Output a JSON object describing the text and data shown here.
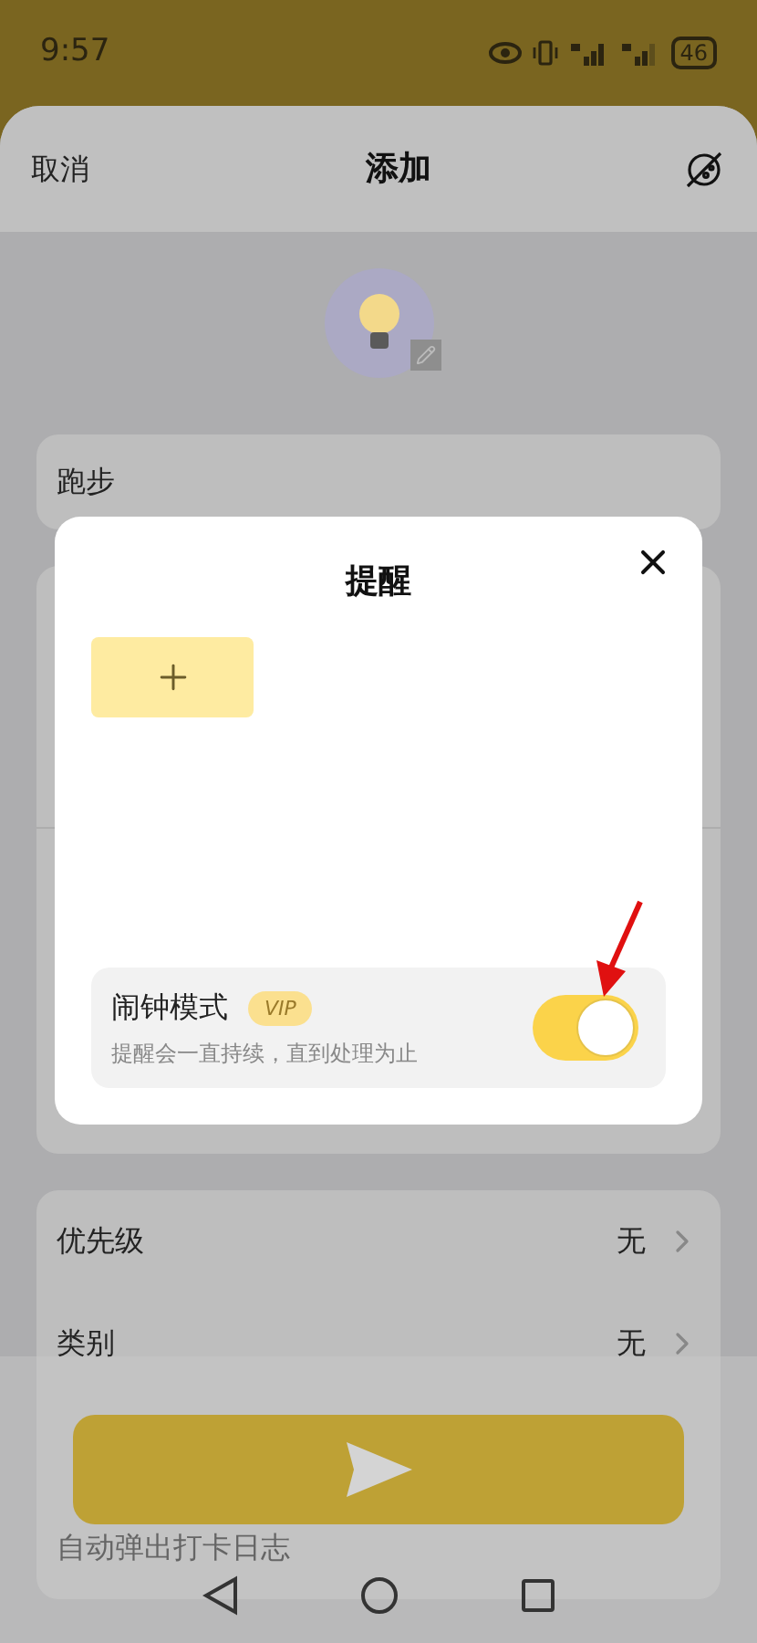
{
  "status_bar": {
    "time": "9:57",
    "battery": "46"
  },
  "header": {
    "cancel": "取消",
    "title": "添加"
  },
  "name_field": {
    "value": "跑步"
  },
  "settings": [
    {
      "kind": "select",
      "label": "优先级",
      "value": "无"
    },
    {
      "kind": "select",
      "label": "类别",
      "value": "无"
    },
    {
      "kind": "label",
      "label": "自动弹出打卡日志"
    }
  ],
  "dialog": {
    "title": "提醒",
    "alarm_mode": {
      "label": "闹钟模式",
      "badge": "VIP",
      "description": "提醒会一直持续，直到处理为止",
      "on": true
    }
  }
}
